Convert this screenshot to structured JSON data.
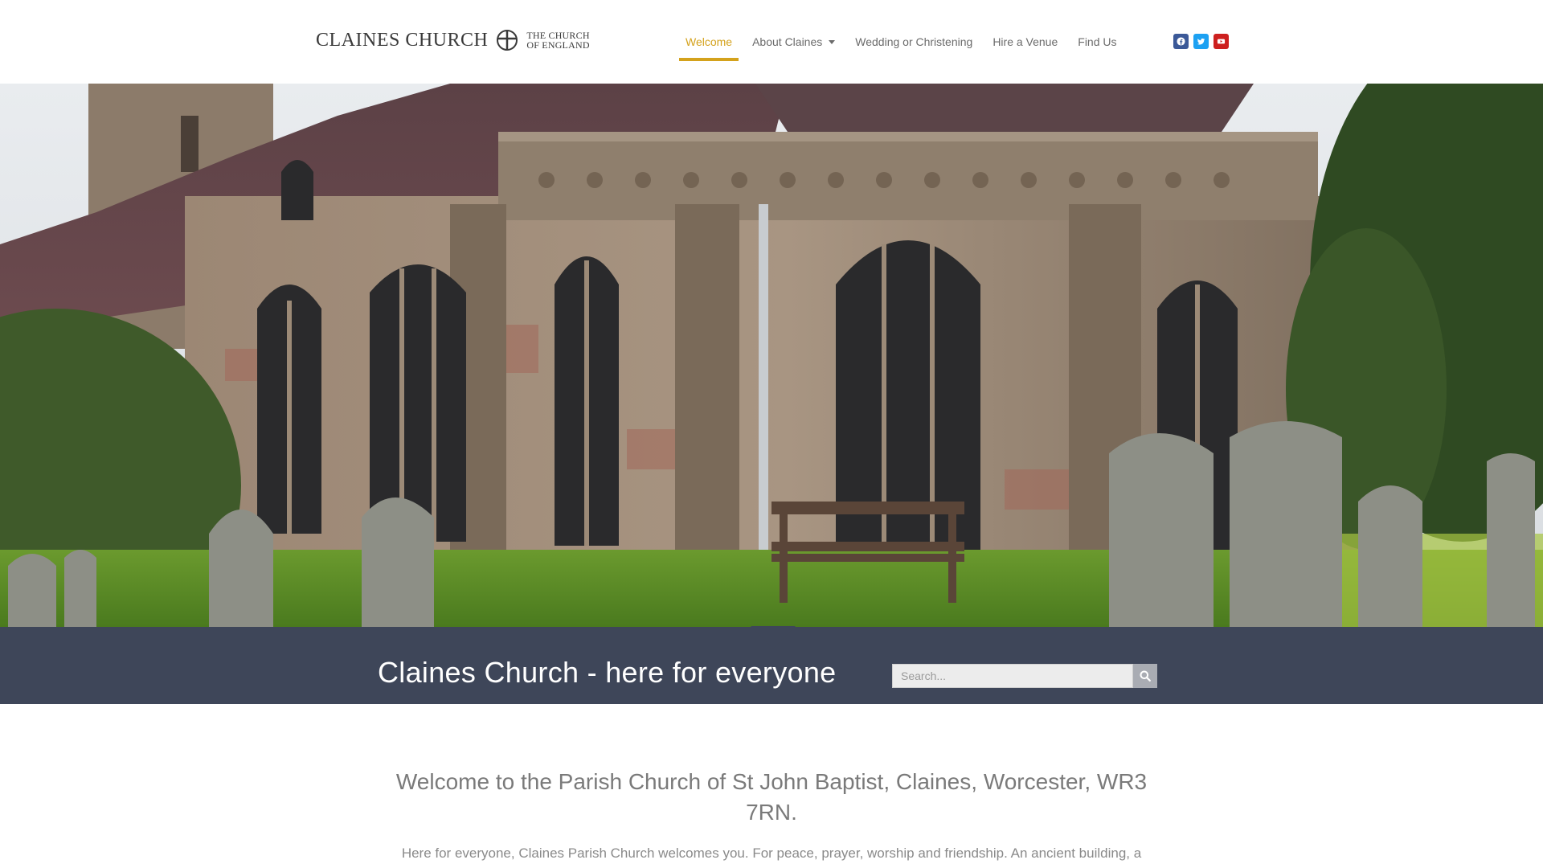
{
  "brand": {
    "name": "CLAINES CHURCH",
    "coe_line1": "THE CHURCH",
    "coe_line2": "OF ENGLAND"
  },
  "nav": {
    "items": [
      {
        "label": "Welcome",
        "active": true
      },
      {
        "label": "About Claines",
        "has_dropdown": true
      },
      {
        "label": "Wedding or Christening"
      },
      {
        "label": "Hire a Venue"
      },
      {
        "label": "Find Us"
      }
    ]
  },
  "social": [
    {
      "icon": "facebook-icon",
      "color": "#3b5998"
    },
    {
      "icon": "twitter-icon",
      "color": "#1da1f2"
    },
    {
      "icon": "youtube-icon",
      "color": "#cd201f"
    }
  ],
  "banner": {
    "title": "Claines Church - here for everyone",
    "search_placeholder": "Search...",
    "background": "#3e4659"
  },
  "content": {
    "heading": "Welcome to the Parish Church of St John Baptist, Claines, Worcester, WR3 7RN.",
    "intro": "Here for everyone, Claines Parish Church welcomes you. For peace, prayer, worship and friendship. An ancient building, a"
  },
  "colors": {
    "accent": "#d4a21c"
  }
}
